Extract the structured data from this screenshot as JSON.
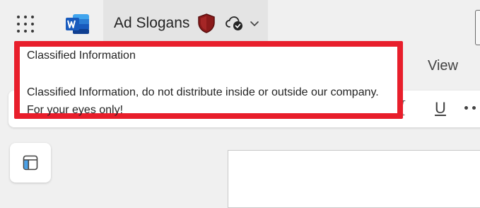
{
  "app": {
    "document_title": "Ad Slogans",
    "icons": {
      "app_launcher": "waffle-icon",
      "app_logo": "word-logo-icon",
      "sensitivity": "shield-icon",
      "save_status": "cloud-check-icon",
      "title_menu": "chevron-down-icon"
    },
    "colors": {
      "word_blue": "#185abd",
      "shield_red": "#8b1a1a",
      "highlight_red": "#e81e2b"
    }
  },
  "ribbon": {
    "tabs": [
      {
        "label": "View"
      }
    ],
    "format": {
      "italic_glyph": "I",
      "underline_glyph": "U"
    }
  },
  "tooltip": {
    "title": "Classified Information",
    "body": "Classified Information, do not distribute inside or outside our company. For your eyes only!"
  }
}
